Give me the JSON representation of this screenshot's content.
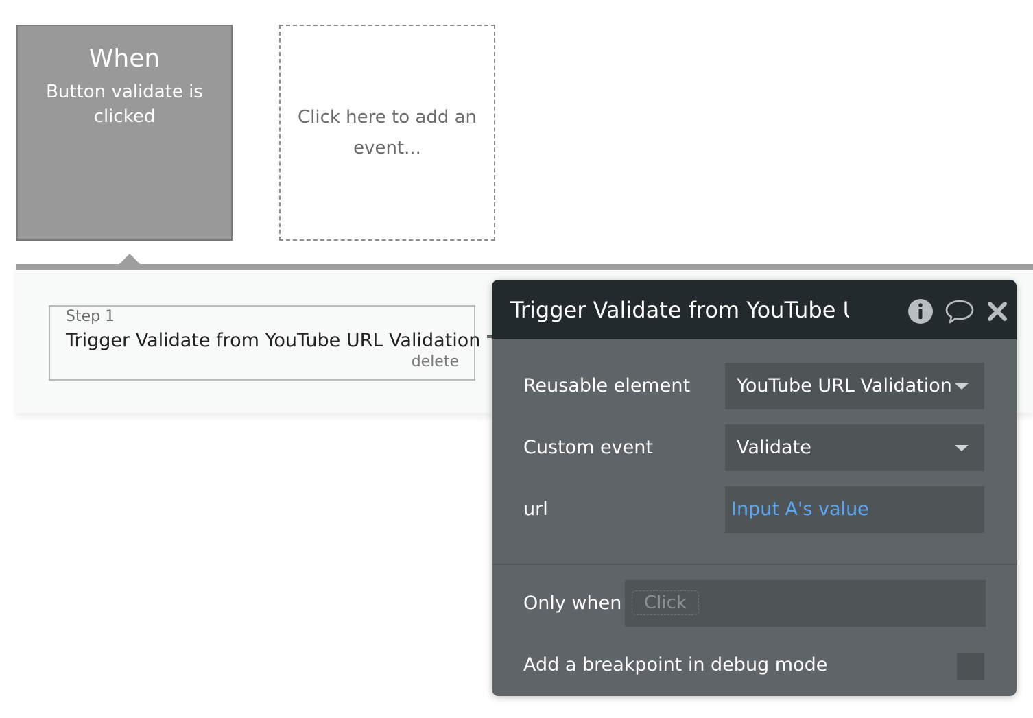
{
  "event": {
    "title": "When",
    "description": "Button validate is clicked"
  },
  "add_event": {
    "label": "Click here to add an event..."
  },
  "step": {
    "number_label": "Step 1",
    "title": "Trigger Validate from YouTube URL Validation",
    "delete_label": "delete"
  },
  "property_editor": {
    "title": "Trigger Validate from YouTube URL Validation",
    "icons": [
      "info-icon",
      "comment-icon",
      "close-icon"
    ],
    "fields": {
      "reusable_element": {
        "label": "Reusable element",
        "value": "YouTube URL Validation"
      },
      "custom_event": {
        "label": "Custom event",
        "value": "Validate"
      },
      "url": {
        "label": "url",
        "value": "Input A's value"
      }
    },
    "only_when": {
      "label": "Only when",
      "placeholder": "Click"
    },
    "breakpoint": {
      "label": "Add a breakpoint in debug mode",
      "checked": false
    }
  },
  "colors": {
    "event_card_bg": "#999999",
    "editor_header_bg": "#232a2d",
    "editor_body_bg": "#5f6468",
    "field_bg": "#4f5457",
    "dynamic_value": "#5aa8f4"
  }
}
